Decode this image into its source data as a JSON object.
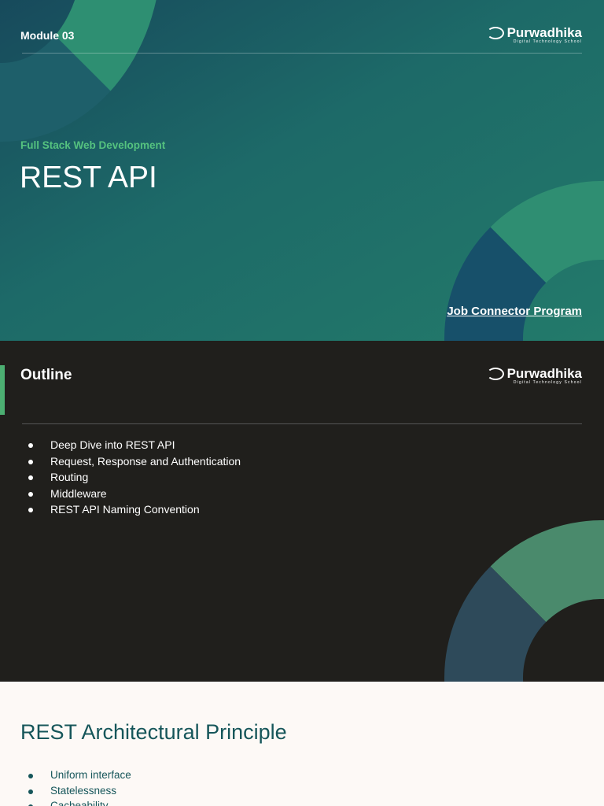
{
  "slide1": {
    "module": "Module 03",
    "subtitle": "Full Stack Web Development",
    "title": "REST API",
    "program": "Job Connector Program"
  },
  "logo": {
    "name": "Purwadhika",
    "tagline": "Digital Technology School"
  },
  "slide2": {
    "title": "Outline",
    "items": [
      "Deep Dive into REST API",
      "Request, Response and Authentication",
      "Routing",
      "Middleware",
      "REST API Naming Convention"
    ]
  },
  "slide3": {
    "title": "REST Architectural Principle",
    "items": [
      "Uniform interface",
      "Statelessness",
      "Cacheability"
    ]
  },
  "colors": {
    "accent": "#4caf72",
    "teal": "#16565a"
  }
}
